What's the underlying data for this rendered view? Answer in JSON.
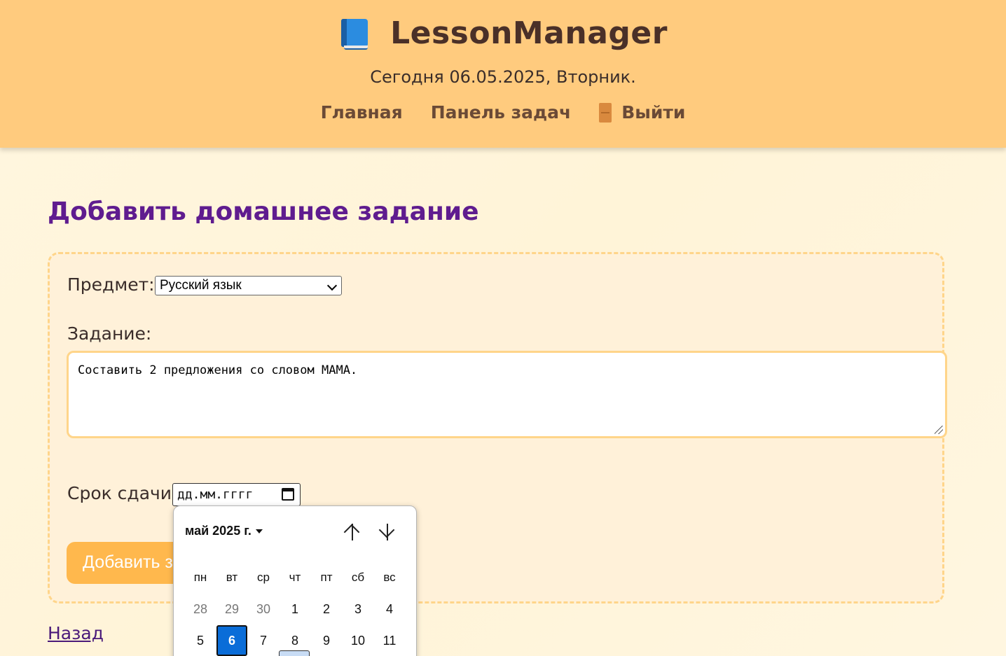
{
  "header": {
    "brand": "LessonManager",
    "today": "Сегодня 06.05.2025, Вторник.",
    "nav": {
      "home": "Главная",
      "tasks": "Панель задач",
      "logout": "Выйти"
    }
  },
  "page_title": "Добавить домашнее задание",
  "form": {
    "subject_label": "Предмет:",
    "subject_value": "Русский язык",
    "task_label": "Задание:",
    "task_value": "Составить 2 предложения со словом МАМА.",
    "due_label": "Срок сдачи:",
    "due_placeholder": "дд.мм.гггг",
    "submit_label": "Добавить задание"
  },
  "back_link": "Назад",
  "calendar": {
    "month_label": "май 2025 г.",
    "weekdays": [
      "пн",
      "вт",
      "ср",
      "чт",
      "пт",
      "сб",
      "вс"
    ],
    "week1": [
      "28",
      "29",
      "30",
      "1",
      "2",
      "3",
      "4"
    ],
    "week2": [
      "5",
      "6",
      "7",
      "8",
      "9",
      "10",
      "11"
    ],
    "selected_day": "6"
  },
  "colors": {
    "header_bg": "#ffcb7e",
    "title": "#5f1c8f",
    "accent_button": "#ffb84d",
    "selected_day": "#0a6dd8"
  }
}
